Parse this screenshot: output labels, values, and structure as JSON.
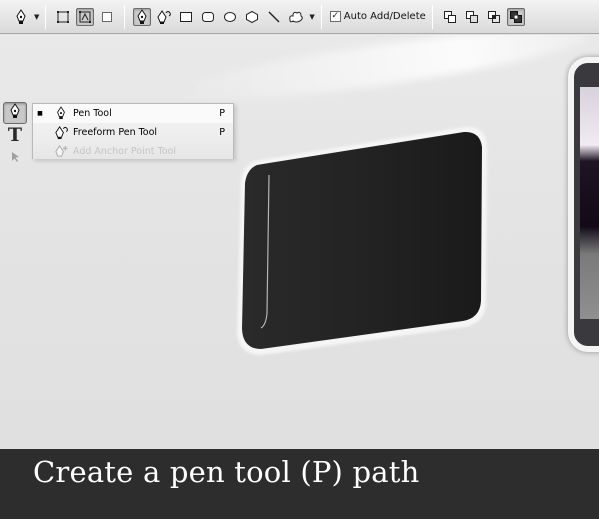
{
  "options_bar": {
    "tool_preset_icon": "pen-icon",
    "path_mode_icons": [
      "shape-layers-icon",
      "paths-icon",
      "fill-pixels-icon"
    ],
    "tool_icons": [
      "pen-icon",
      "freeform-pen-icon",
      "rectangle-icon",
      "rounded-rectangle-icon",
      "ellipse-icon",
      "polygon-icon",
      "line-icon",
      "custom-shape-icon"
    ],
    "auto_add_delete": {
      "label": "Auto Add/Delete",
      "checked": true
    },
    "path_ops_icons": [
      "add-to-path-icon",
      "subtract-from-path-icon",
      "intersect-path-icon",
      "exclude-overlap-icon"
    ]
  },
  "tools_panel": {
    "active_tool_icon": "pen-icon",
    "type_tool_glyph": "T",
    "below_icon": "path-selection-icon"
  },
  "flyout": {
    "items": [
      {
        "label": "Pen Tool",
        "shortcut": "P",
        "icon": "pen-icon",
        "selected": true
      },
      {
        "label": "Freeform Pen Tool",
        "shortcut": "P",
        "icon": "freeform-pen-icon",
        "selected": false
      },
      {
        "label": "Add Anchor Point Tool",
        "shortcut": "",
        "icon": "add-anchor-point-icon",
        "selected": false
      }
    ]
  },
  "caption": {
    "text": "Create a pen tool (P) path"
  },
  "colors": {
    "toolbar_bg": "#e2e2e2",
    "canvas_bg": "#e4e4e4",
    "device_body": "#262626",
    "caption_bg": "#2d2d2d",
    "caption_text": "#ffffff"
  }
}
